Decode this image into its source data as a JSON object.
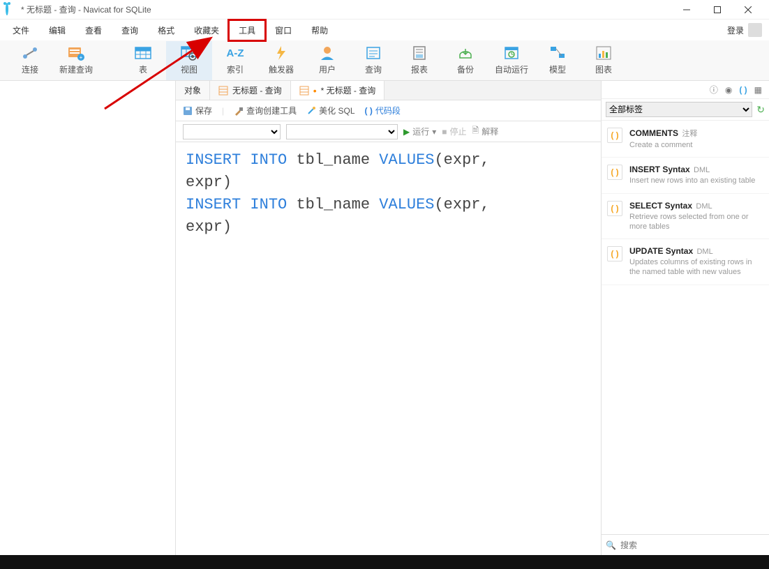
{
  "window": {
    "title": "* 无标题 - 查询 - Navicat for SQLite"
  },
  "menu": {
    "items": [
      "文件",
      "编辑",
      "查看",
      "查询",
      "格式",
      "收藏夹",
      "工具",
      "窗口",
      "帮助"
    ],
    "login": "登录"
  },
  "toolbar": {
    "items": [
      "连接",
      "新建查询",
      "表",
      "视图",
      "索引",
      "触发器",
      "用户",
      "查询",
      "报表",
      "备份",
      "自动运行",
      "模型",
      "图表"
    ]
  },
  "tabs": {
    "t0": "对象",
    "t1": "无标题 - 查询",
    "t2": "* 无标题 - 查询"
  },
  "subtoolbar": {
    "save": "保存",
    "builder": "查询创建工具",
    "beautify": "美化 SQL",
    "snippet": "代码段"
  },
  "runbar": {
    "run": "运行",
    "stop": "停止",
    "explain": "解释"
  },
  "sql": {
    "k_insert": "INSERT",
    "k_into": "INTO",
    "tbl": "tbl_name",
    "k_values": "VALUES",
    "args": "(expr,",
    "args2": "expr)"
  },
  "right": {
    "filter": "全部标签",
    "search_placeholder": "搜索"
  },
  "snippets": [
    {
      "title": "COMMENTS",
      "tag": "注释",
      "desc": "Create a comment"
    },
    {
      "title": "INSERT Syntax",
      "tag": "DML",
      "desc": "Insert new rows into an existing table"
    },
    {
      "title": "SELECT Syntax",
      "tag": "DML",
      "desc": "Retrieve rows selected from one or more tables"
    },
    {
      "title": "UPDATE Syntax",
      "tag": "DML",
      "desc": "Updates columns of existing rows in the named table with new values"
    }
  ]
}
